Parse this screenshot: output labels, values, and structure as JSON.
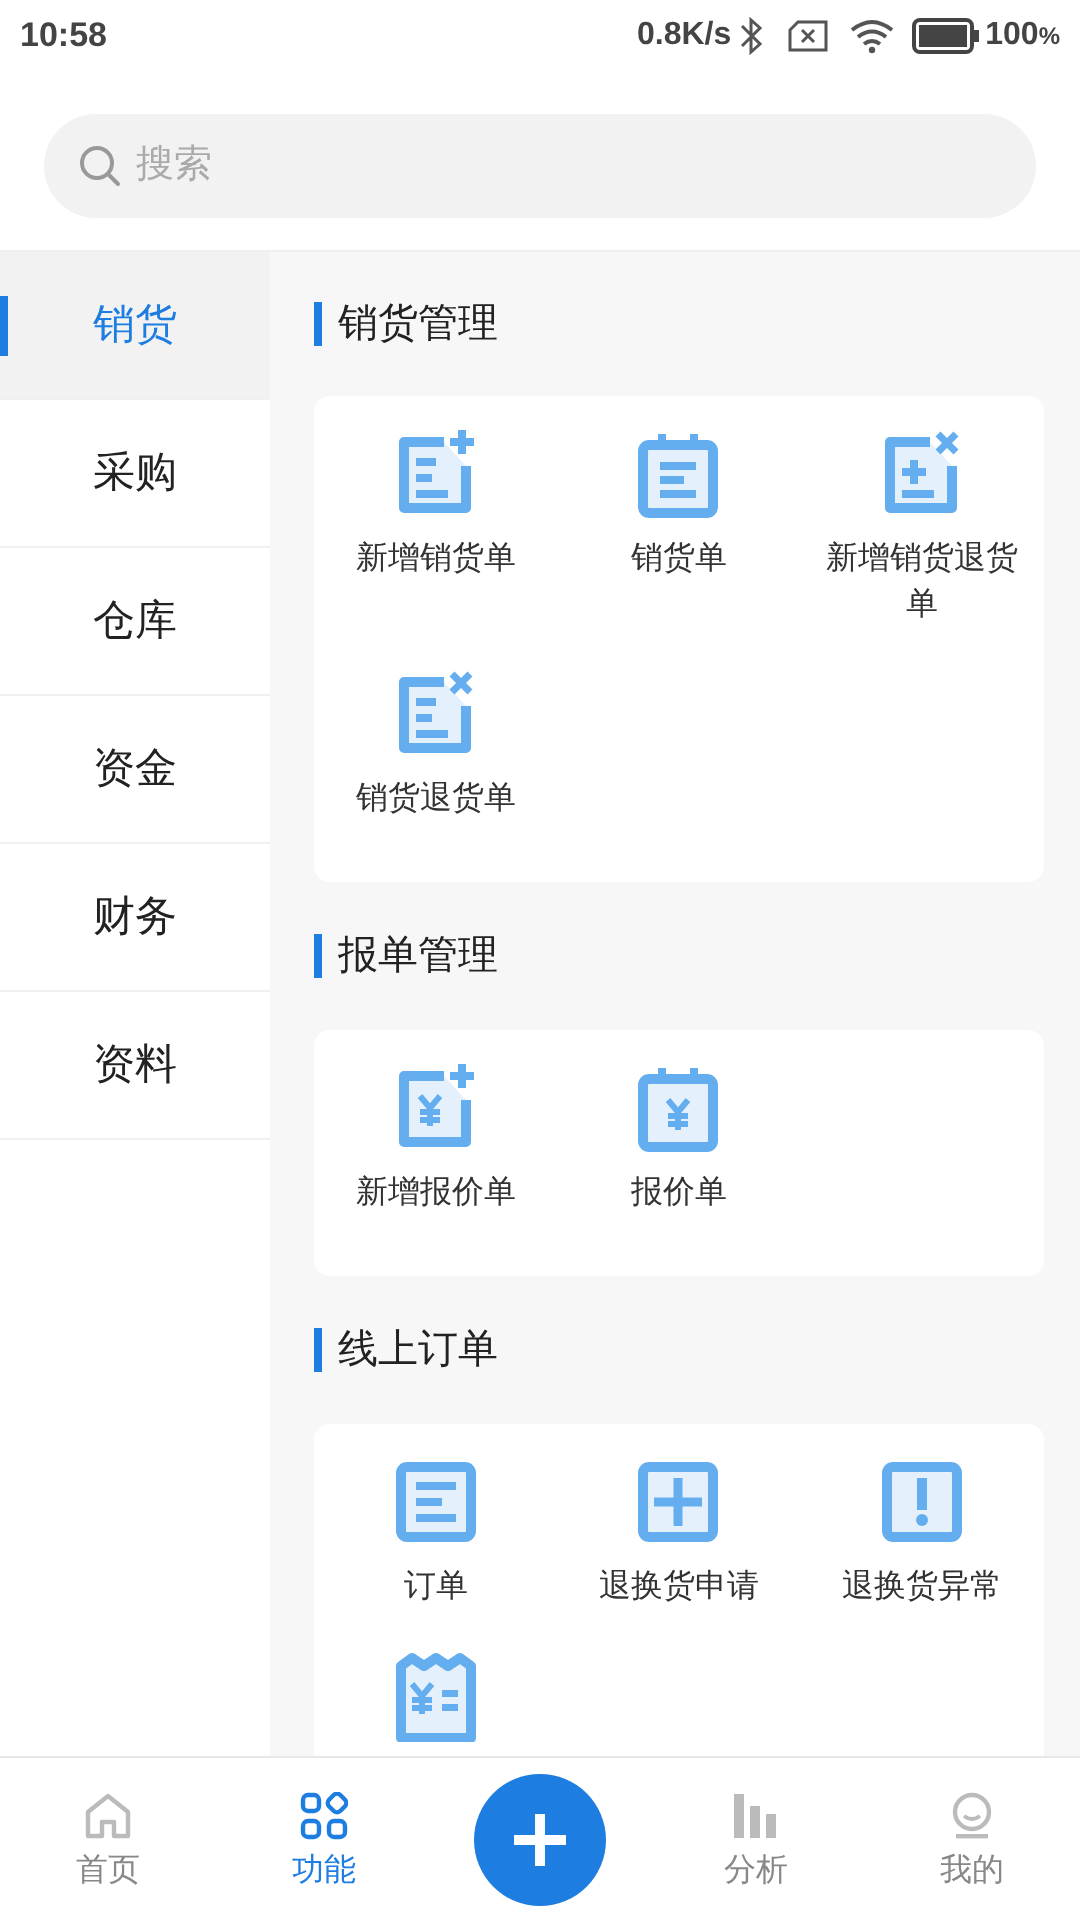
{
  "status_bar": {
    "time": "10:58",
    "net_speed": "0.8K/s",
    "battery": "100",
    "battery_unit": "%"
  },
  "search": {
    "placeholder": "搜索"
  },
  "sidebar": {
    "items": [
      {
        "label": "销货",
        "selected": true
      },
      {
        "label": "采购",
        "selected": false
      },
      {
        "label": "仓库",
        "selected": false
      },
      {
        "label": "资金",
        "selected": false
      },
      {
        "label": "财务",
        "selected": false
      },
      {
        "label": "资料",
        "selected": false
      }
    ]
  },
  "sections": [
    {
      "title": "销货管理",
      "items": [
        {
          "label": "新增销货单",
          "kind": "docplus"
        },
        {
          "label": "销货单",
          "kind": "clipboard"
        },
        {
          "label": "新增销货退货单",
          "kind": "docpm"
        },
        {
          "label": "销货退货单",
          "kind": "docx"
        }
      ]
    },
    {
      "title": "报单管理",
      "items": [
        {
          "label": "新增报价单",
          "kind": "yenplus"
        },
        {
          "label": "报价单",
          "kind": "yenclip"
        }
      ]
    },
    {
      "title": "线上订单",
      "items": [
        {
          "label": "订单",
          "kind": "list"
        },
        {
          "label": "退换货申请",
          "kind": "plussquare"
        },
        {
          "label": "退换货异常",
          "kind": "exclaim"
        },
        {
          "kind": "receipt"
        }
      ]
    }
  ],
  "bottom_nav": {
    "tabs": [
      {
        "label": "首页",
        "kind": "home",
        "selected": false
      },
      {
        "label": "功能",
        "kind": "apps",
        "selected": true
      },
      {
        "label": "分析",
        "kind": "bars",
        "selected": false
      },
      {
        "label": "我的",
        "kind": "user",
        "selected": false
      }
    ]
  }
}
